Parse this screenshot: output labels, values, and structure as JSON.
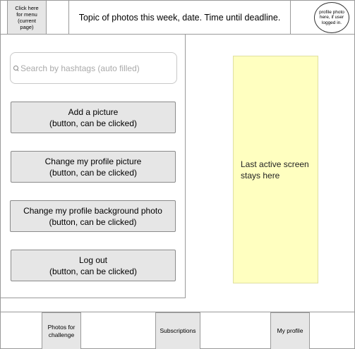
{
  "header": {
    "menu_button": "Click here\nfor menu\n(current\npage)",
    "topic": "Topic of photos this week, date. Time until deadline.",
    "profile_photo": "profile photo\nhere, if user\nlogged in."
  },
  "menu": {
    "search": {
      "placeholder": "Search by hashtags (auto filled)",
      "value": ""
    },
    "buttons": [
      {
        "label": "Add a picture",
        "note": "(button, can be clicked)"
      },
      {
        "label": "Change my profile picture",
        "note": "(button, can be clicked)"
      },
      {
        "label": "Change my profile background photo",
        "note": "(button, can be clicked)"
      },
      {
        "label": "Log out",
        "note": "(button, can be clicked)"
      }
    ]
  },
  "main": {
    "placeholder": "Last active screen stays here"
  },
  "bottom_nav": {
    "tabs": [
      {
        "label": "Photos for\nchallenge"
      },
      {
        "label": "Subscriptions"
      },
      {
        "label": "My profile"
      }
    ]
  },
  "colors": {
    "button_fill": "#e6e6e6",
    "border": "#9a9a9a",
    "placeholder_note": "#ffffc0"
  }
}
